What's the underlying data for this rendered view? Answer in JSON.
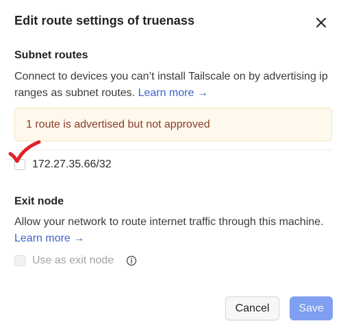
{
  "dialog": {
    "title": "Edit route settings of truenass",
    "close_icon": "close-icon"
  },
  "subnet": {
    "heading": "Subnet routes",
    "description": "Connect to devices you can’t install Tailscale on by advertising ip ranges as subnet routes.",
    "learn_more": "Learn more →",
    "warning": "1 route is advertised but not approved",
    "routes": [
      {
        "label": "172.27.35.66/32",
        "checked": false
      }
    ]
  },
  "exit_node": {
    "heading": "Exit node",
    "description": "Allow your network to route internet traffic through this machine.",
    "learn_more": "Learn more →",
    "checkbox_label": "Use as exit node",
    "checked": false,
    "disabled": true,
    "info_icon": "info-icon"
  },
  "footer": {
    "cancel_label": "Cancel",
    "save_label": "Save"
  },
  "colors": {
    "link": "#3b64c8",
    "warning_bg": "#fef9ec",
    "warning_text": "#8a3a2a",
    "save_button": "#7fa0f0",
    "annotation_check": "#e0202a"
  }
}
